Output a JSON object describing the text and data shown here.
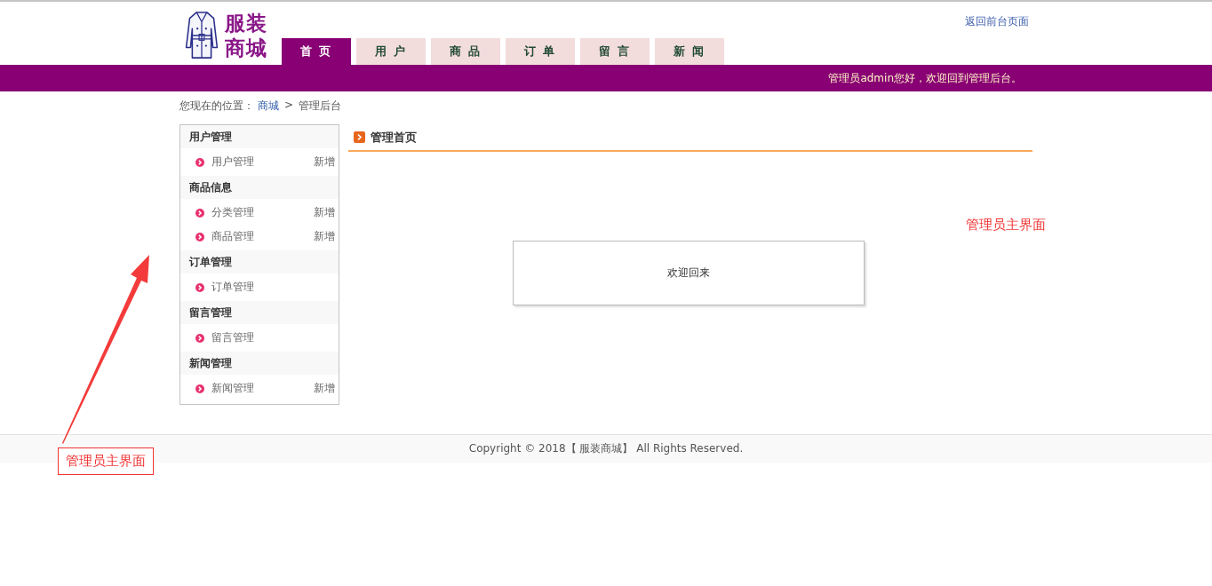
{
  "header": {
    "logo_lines": [
      "服装",
      "商城"
    ],
    "back_link": "返回前台页面",
    "tabs": [
      {
        "label": "首 页",
        "selected": true
      },
      {
        "label": "用 户",
        "selected": false
      },
      {
        "label": "商 品",
        "selected": false
      },
      {
        "label": "订 单",
        "selected": false
      },
      {
        "label": "留 言",
        "selected": false
      },
      {
        "label": "新 闻",
        "selected": false
      }
    ],
    "greeting": "管理员admin您好，欢迎回到管理后台。"
  },
  "breadcrumb": {
    "prefix": "您现在的位置：",
    "link": "商城",
    "separator": ">",
    "current": "管理后台"
  },
  "sidebar": [
    {
      "title": "用户管理",
      "items": [
        {
          "label": "用户管理",
          "add": "新增"
        }
      ]
    },
    {
      "title": "商品信息",
      "items": [
        {
          "label": "分类管理",
          "add": "新增"
        },
        {
          "label": "商品管理",
          "add": "新增"
        }
      ]
    },
    {
      "title": "订单管理",
      "items": [
        {
          "label": "订单管理"
        }
      ]
    },
    {
      "title": "留言管理",
      "items": [
        {
          "label": "留言管理"
        }
      ]
    },
    {
      "title": "新闻管理",
      "items": [
        {
          "label": "新闻管理",
          "add": "新增"
        }
      ]
    }
  ],
  "main": {
    "title": "管理首页",
    "welcome": "欢迎回来"
  },
  "footer": "Copyright © 2018【 服装商城】 All Rights Reserved.",
  "annotations": [
    {
      "text": "管理员主界面",
      "boxed": false
    },
    {
      "text": "管理员主界面",
      "boxed": true
    }
  ]
}
